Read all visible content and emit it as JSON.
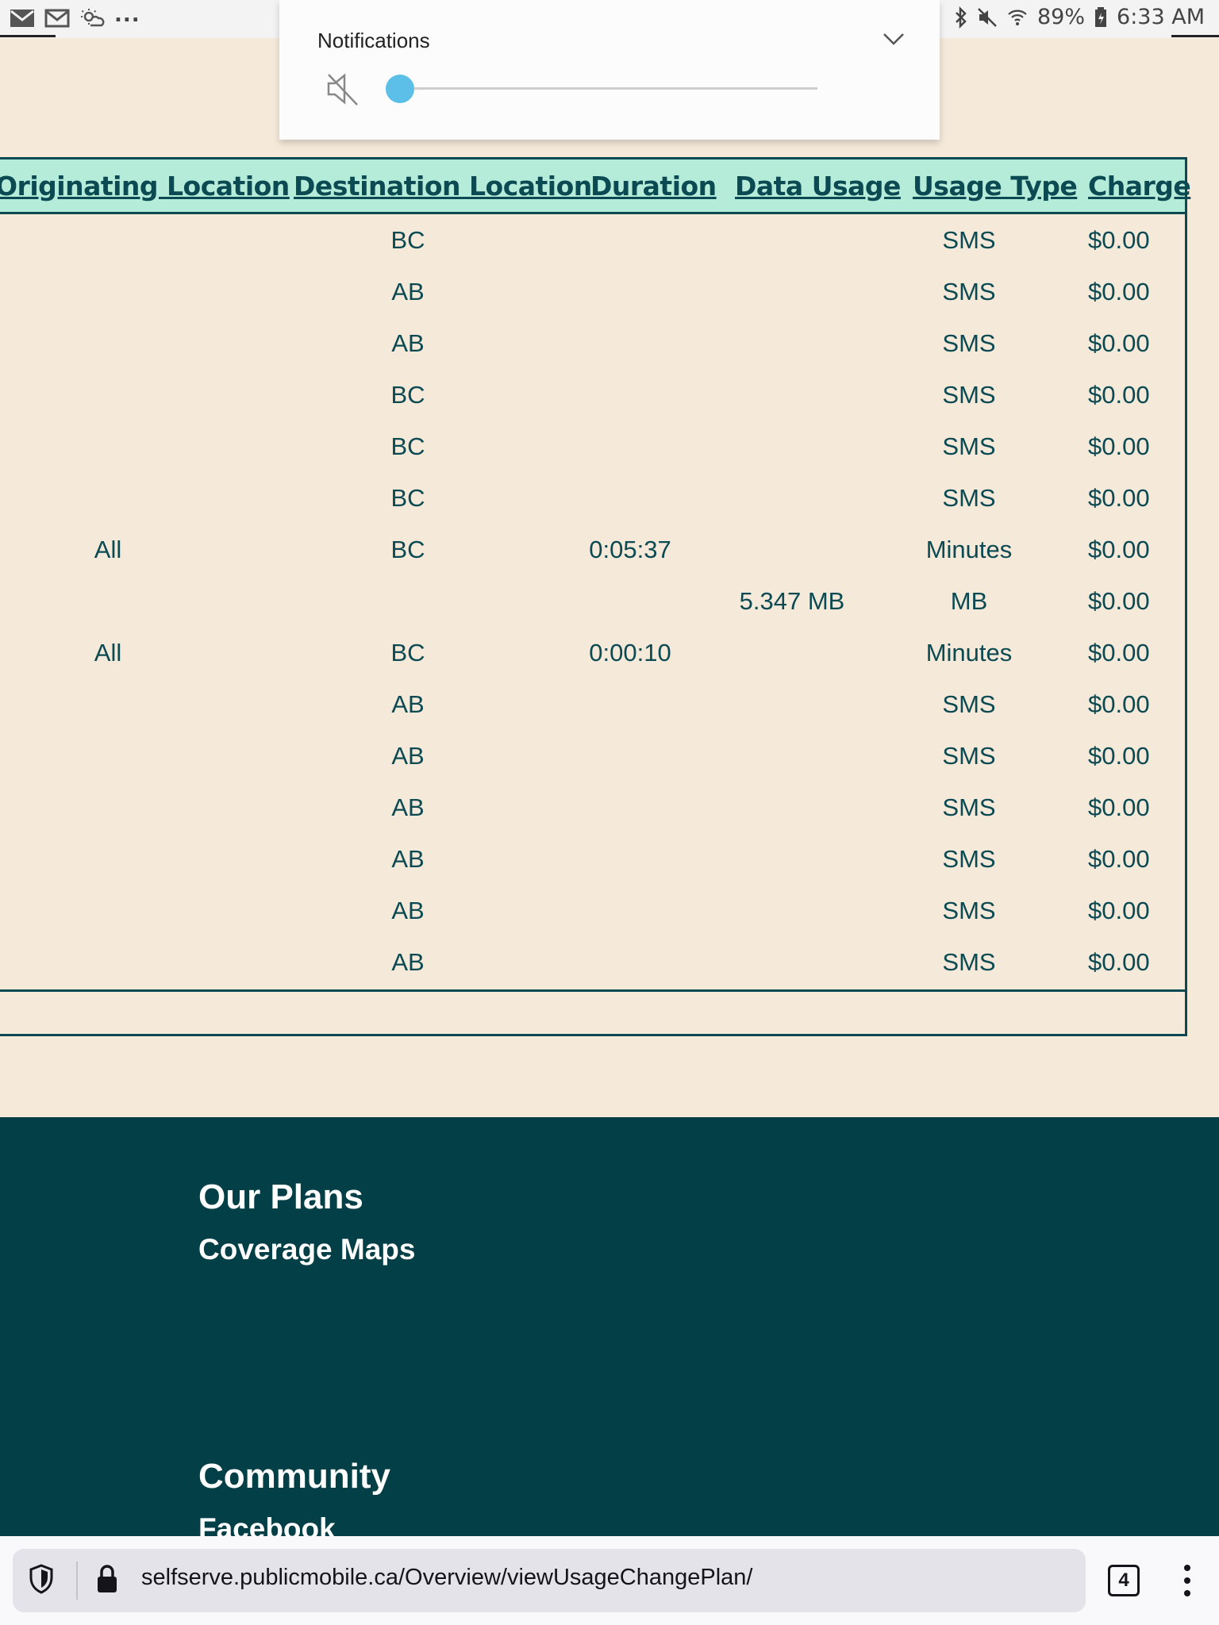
{
  "status_bar": {
    "left_icons": [
      "mail-icon",
      "gmail-icon",
      "weather-icon"
    ],
    "more": "...",
    "right_icons": [
      "bluetooth-icon",
      "mute-icon",
      "wifi-icon",
      "battery-icon"
    ],
    "battery": "89%",
    "time": "6:33 AM"
  },
  "volume_panel": {
    "title": "Notifications",
    "level": 0
  },
  "table": {
    "headers": [
      "Originating Location",
      "Destination Location",
      "Duration",
      "Data Usage",
      "Usage Type",
      "Charge"
    ],
    "rows": [
      {
        "orig": "",
        "dest": "BC",
        "duration": "",
        "data": "",
        "type": "SMS",
        "charge": "$0.00"
      },
      {
        "orig": "",
        "dest": "AB",
        "duration": "",
        "data": "",
        "type": "SMS",
        "charge": "$0.00"
      },
      {
        "orig": "",
        "dest": "AB",
        "duration": "",
        "data": "",
        "type": "SMS",
        "charge": "$0.00"
      },
      {
        "orig": "",
        "dest": "BC",
        "duration": "",
        "data": "",
        "type": "SMS",
        "charge": "$0.00"
      },
      {
        "orig": "",
        "dest": "BC",
        "duration": "",
        "data": "",
        "type": "SMS",
        "charge": "$0.00"
      },
      {
        "orig": "",
        "dest": "BC",
        "duration": "",
        "data": "",
        "type": "SMS",
        "charge": "$0.00"
      },
      {
        "orig": "All",
        "dest": "BC",
        "duration": "0:05:37",
        "data": "",
        "type": "Minutes",
        "charge": "$0.00"
      },
      {
        "orig": "",
        "dest": "",
        "duration": "",
        "data": "5.347 MB",
        "type": "MB",
        "charge": "$0.00"
      },
      {
        "orig": "All",
        "dest": "BC",
        "duration": "0:00:10",
        "data": "",
        "type": "Minutes",
        "charge": "$0.00"
      },
      {
        "orig": "",
        "dest": "AB",
        "duration": "",
        "data": "",
        "type": "SMS",
        "charge": "$0.00"
      },
      {
        "orig": "",
        "dest": "AB",
        "duration": "",
        "data": "",
        "type": "SMS",
        "charge": "$0.00"
      },
      {
        "orig": "",
        "dest": "AB",
        "duration": "",
        "data": "",
        "type": "SMS",
        "charge": "$0.00"
      },
      {
        "orig": "",
        "dest": "AB",
        "duration": "",
        "data": "",
        "type": "SMS",
        "charge": "$0.00"
      },
      {
        "orig": "",
        "dest": "AB",
        "duration": "",
        "data": "",
        "type": "SMS",
        "charge": "$0.00"
      },
      {
        "orig": "",
        "dest": "AB",
        "duration": "",
        "data": "",
        "type": "SMS",
        "charge": "$0.00"
      }
    ]
  },
  "footer": {
    "plans": "Our Plans",
    "coverage": "Coverage Maps",
    "community": "Community",
    "facebook": "Facebook"
  },
  "browser": {
    "url": "selfserve.publicmobile.ca/Overview/viewUsageChangePlan/",
    "tab_count": "4"
  },
  "colors": {
    "page_bg": "#f5e9da",
    "header_bg": "#b5ebd9",
    "text": "#0b4a52",
    "footer_bg": "#033f47",
    "slider_thumb": "#5bbfe8"
  }
}
